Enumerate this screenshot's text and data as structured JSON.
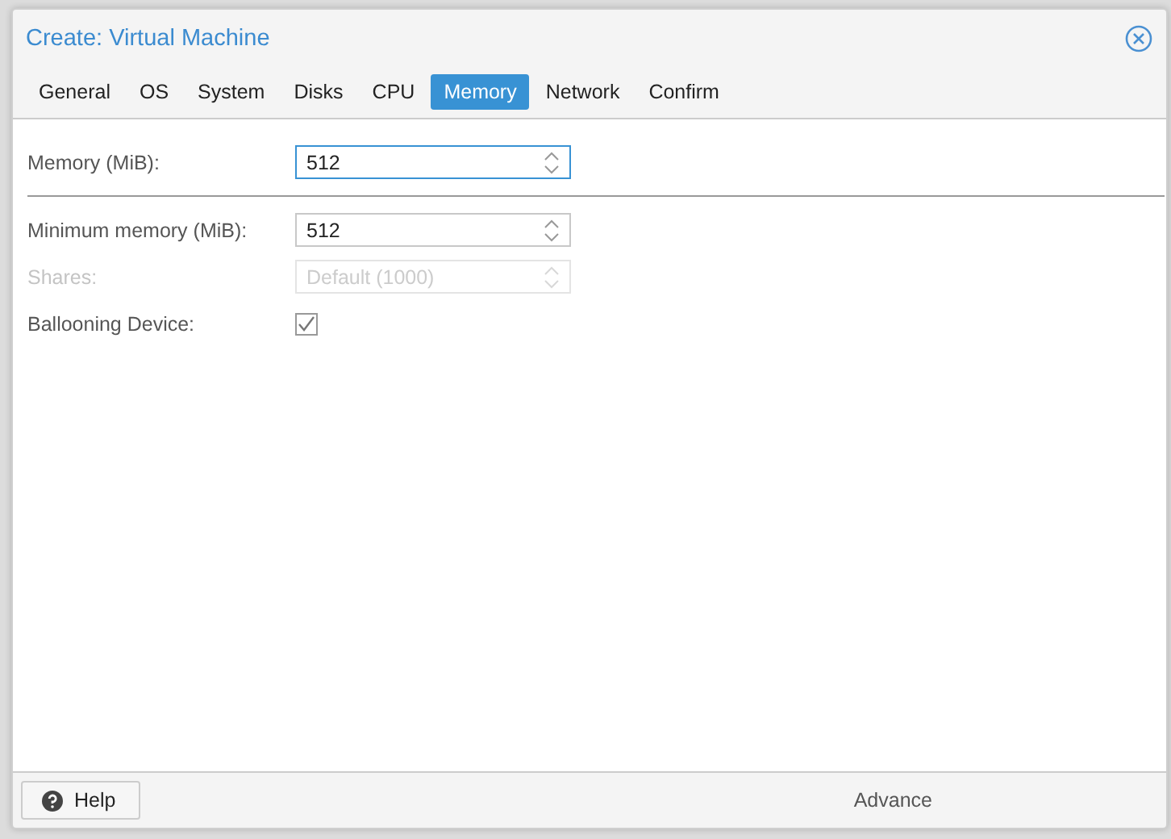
{
  "window": {
    "title": "Create: Virtual Machine"
  },
  "tabs": [
    {
      "label": "General",
      "selected": false
    },
    {
      "label": "OS",
      "selected": false
    },
    {
      "label": "System",
      "selected": false
    },
    {
      "label": "Disks",
      "selected": false
    },
    {
      "label": "CPU",
      "selected": false
    },
    {
      "label": "Memory",
      "selected": true
    },
    {
      "label": "Network",
      "selected": false
    },
    {
      "label": "Confirm",
      "selected": false
    }
  ],
  "fields": [
    {
      "kind": "spinner",
      "label": "Memory (MiB):",
      "value": "512",
      "focused": true,
      "disabled": false
    },
    {
      "kind": "divider"
    },
    {
      "kind": "spinner",
      "label": "Minimum memory (MiB):",
      "value": "512",
      "focused": false,
      "disabled": false
    },
    {
      "kind": "spinner",
      "label": "Shares:",
      "placeholder": "Default (1000)",
      "focused": false,
      "disabled": true
    },
    {
      "kind": "checkbox",
      "label": "Ballooning Device:",
      "checked": true,
      "disabled": false
    }
  ],
  "footer": {
    "help_button": "Help",
    "advanced_label": "Advance"
  }
}
